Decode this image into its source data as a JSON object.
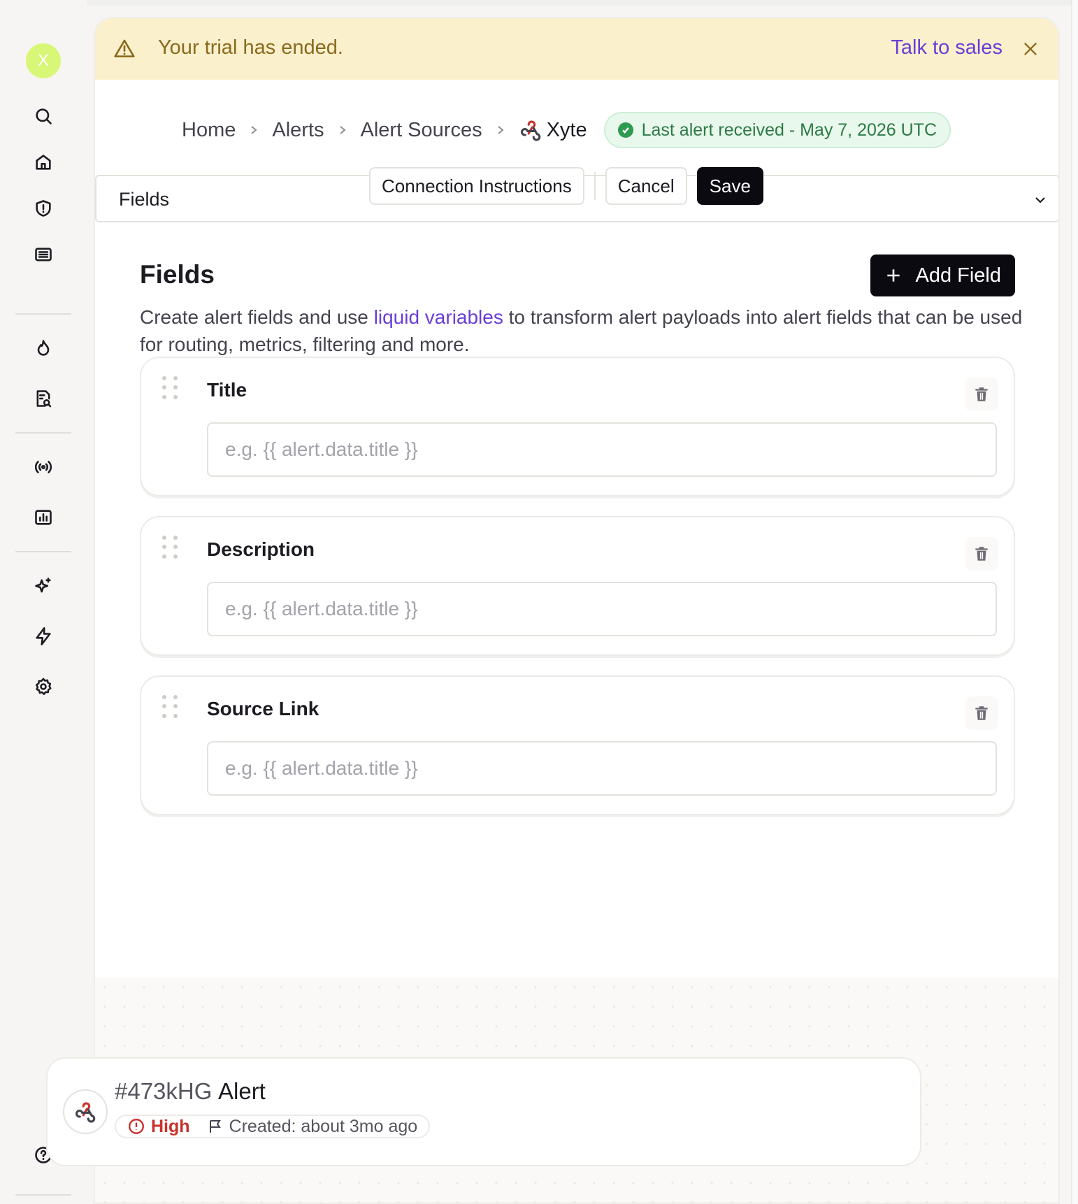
{
  "sidebar": {
    "avatar_letter": "X",
    "items": [
      {
        "icon": "search-icon"
      },
      {
        "icon": "home-icon"
      },
      {
        "icon": "shield-alert-icon"
      },
      {
        "icon": "catalog-icon"
      },
      {
        "icon": "flame-icon"
      },
      {
        "icon": "search-document-icon"
      },
      {
        "icon": "broadcast-icon"
      },
      {
        "icon": "chart-icon"
      },
      {
        "icon": "sparkles-icon"
      },
      {
        "icon": "lightning-icon"
      },
      {
        "icon": "gear-icon"
      },
      {
        "icon": "help-icon"
      }
    ]
  },
  "banner": {
    "message": "Your trial has ended.",
    "cta": "Talk to sales"
  },
  "breadcrumb": {
    "items": [
      "Home",
      "Alerts",
      "Alert Sources"
    ],
    "current": "Xyte",
    "status": "Last alert received - May 7, 2026 UTC"
  },
  "toolbar": {
    "select_label": "Fields",
    "connection_instructions": "Connection Instructions",
    "cancel": "Cancel",
    "save": "Save"
  },
  "fields_section": {
    "title": "Fields",
    "add_button": "Add Field",
    "desc_before": "Create alert fields and use ",
    "desc_link": "liquid variables",
    "desc_after": " to transform alert payloads into alert fields that can be used for routing, metrics, filtering and more.",
    "fields": [
      {
        "name": "Title",
        "placeholder": "e.g. {{ alert.data.title }}",
        "value": ""
      },
      {
        "name": "Description",
        "placeholder": "e.g. {{ alert.data.title }}",
        "value": ""
      },
      {
        "name": "Source Link",
        "placeholder": "e.g. {{ alert.data.title }}",
        "value": ""
      }
    ]
  },
  "preview": {
    "alert_id": "#473kHG",
    "alert_title": "Alert",
    "severity": "High",
    "created": "Created: about 3mo ago"
  },
  "colors": {
    "accent": "#6a3ed6",
    "banner_bg": "#fbf0cc",
    "success": "#2d9b50",
    "danger": "#c8322c"
  }
}
